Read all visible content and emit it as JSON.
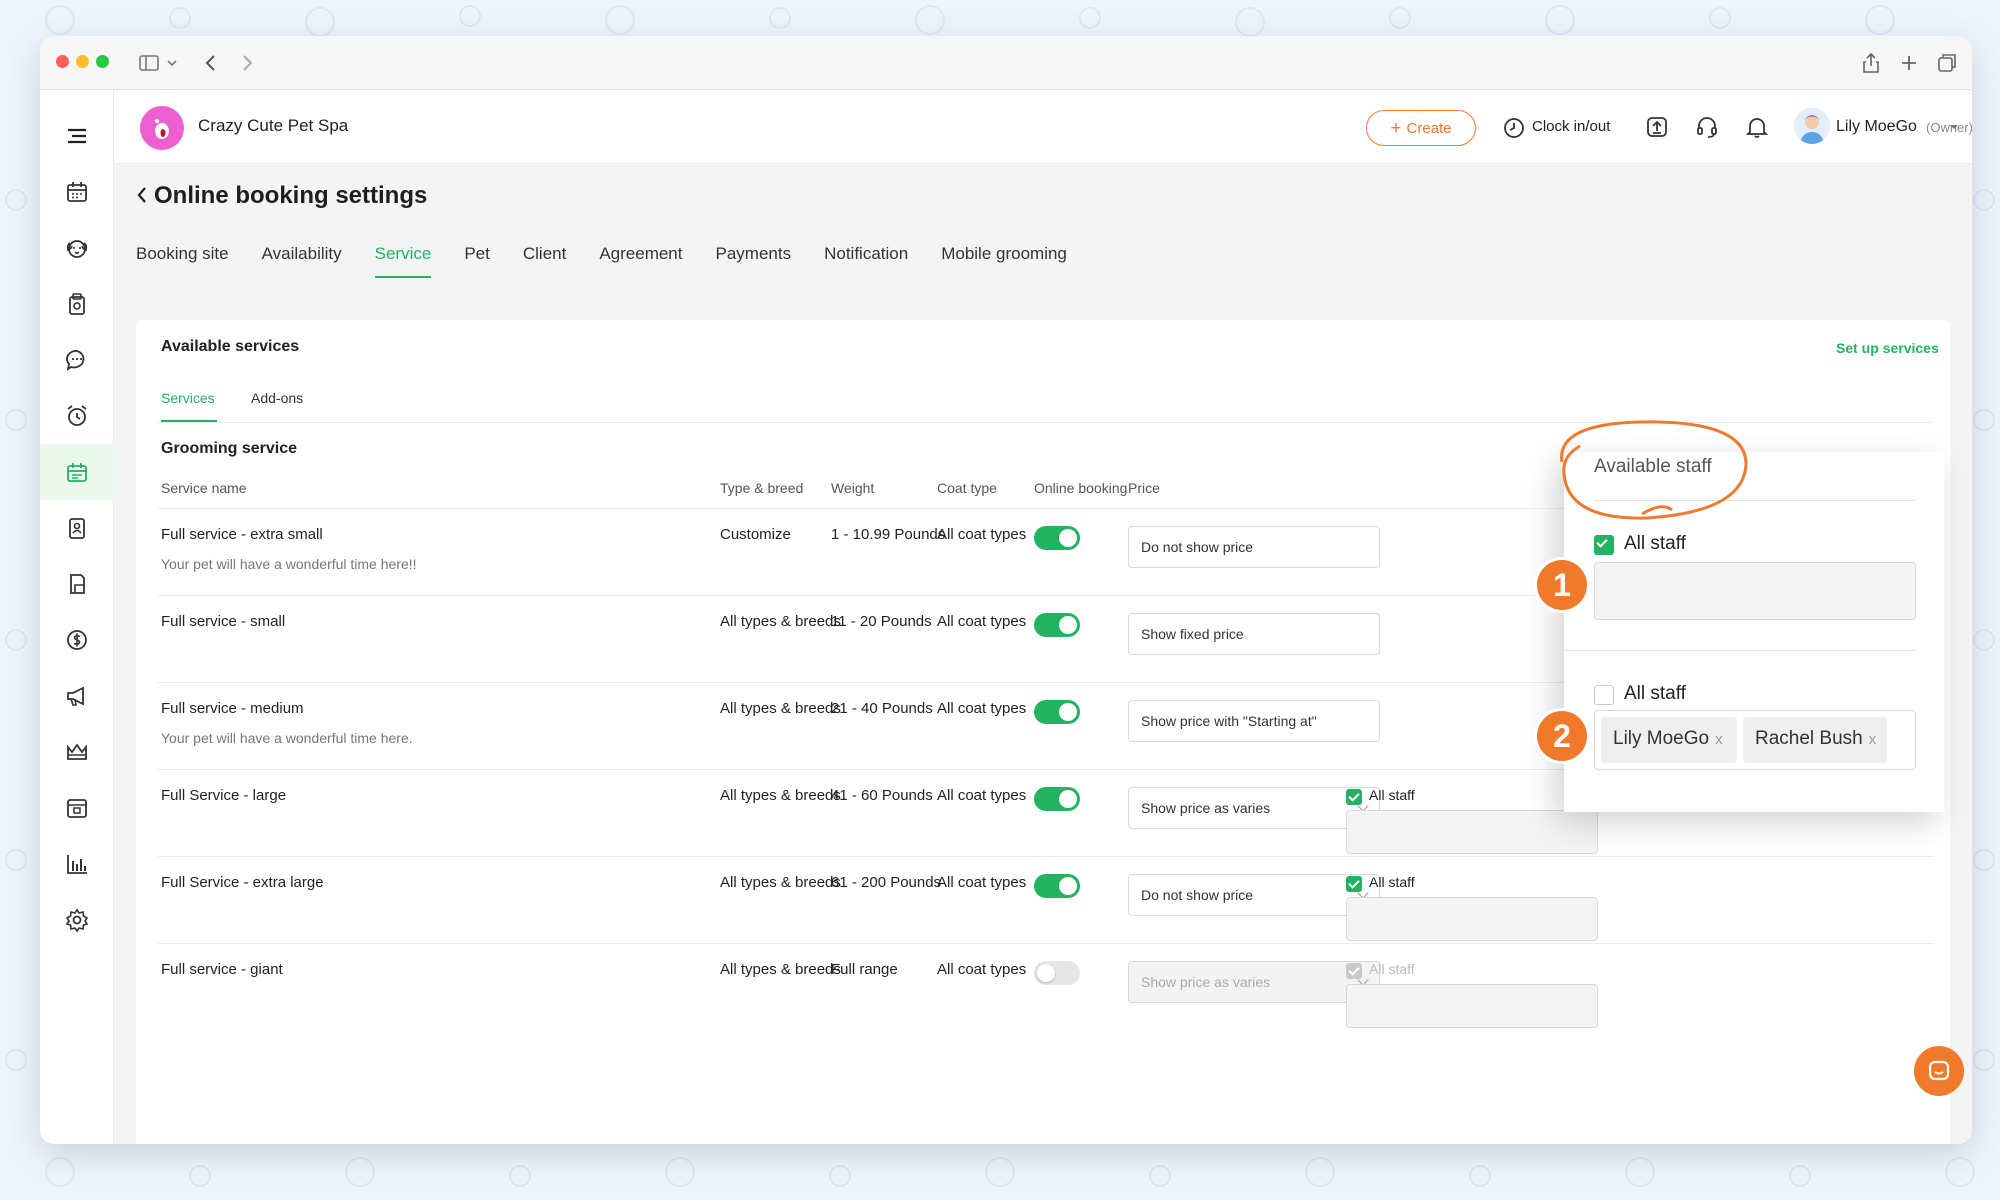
{
  "business": {
    "name": "Crazy Cute Pet Spa"
  },
  "topbar": {
    "create": "Create",
    "clock": "Clock in/out",
    "user_name": "Lily MoeGo",
    "user_role": "(Owner)"
  },
  "page": {
    "title": "Online booking settings"
  },
  "tabs": [
    "Booking site",
    "Availability",
    "Service",
    "Pet",
    "Client",
    "Agreement",
    "Payments",
    "Notification",
    "Mobile grooming"
  ],
  "active_tab": "Service",
  "card": {
    "title": "Available services",
    "setup_link": "Set up services",
    "subtabs": [
      "Services",
      "Add-ons"
    ],
    "section": "Grooming service",
    "headers": {
      "name": "Service name",
      "type": "Type & breed",
      "weight": "Weight",
      "coat": "Coat type",
      "online": "Online booking",
      "price": "Price"
    }
  },
  "rows": [
    {
      "name": "Full service - extra small",
      "desc": "Your pet will have a wonderful time here!!",
      "type": "Customize",
      "weight": "1 - 10.99 Pounds",
      "coat": "All coat types",
      "online": true,
      "price": "Do not show price"
    },
    {
      "name": "Full service - small",
      "desc": "",
      "type": "All types & breeds",
      "weight": "11 - 20 Pounds",
      "coat": "All coat types",
      "online": true,
      "price": "Show fixed price"
    },
    {
      "name": "Full service - medium",
      "desc": "Your pet will have a wonderful time here.",
      "type": "All types & breeds",
      "weight": "21 - 40 Pounds",
      "coat": "All coat types",
      "online": true,
      "price": "Show price with \"Starting at\""
    },
    {
      "name": "Full Service - large",
      "desc": "",
      "type": "All types & breeds",
      "weight": "41 - 60 Pounds",
      "coat": "All coat types",
      "online": true,
      "price": "Show price as varies",
      "staff": "All staff"
    },
    {
      "name": "Full Service - extra large",
      "desc": "",
      "type": "All types & breeds",
      "weight": "61 - 200 Pounds",
      "coat": "All coat types",
      "online": true,
      "price": "Do not show price",
      "staff": "All staff"
    },
    {
      "name": "Full service - giant",
      "desc": "",
      "type": "All types & breeds",
      "weight": "Full range",
      "coat": "All coat types",
      "online": false,
      "price": "Show price as varies",
      "staff": "All staff"
    }
  ],
  "popup": {
    "title": "Available staff",
    "option1": "All staff",
    "option2": "All staff",
    "chips": [
      "Lily MoeGo",
      "Rachel Bush"
    ],
    "chip_close": "x",
    "badge1": "1",
    "badge2": "2"
  },
  "colors": {
    "brand_green": "#21b35f",
    "accent_orange": "#f0792c",
    "page_bg": "#f4f4f4"
  },
  "icons": {
    "sidebar": [
      "calendar-icon",
      "pet-face-icon",
      "clipboard-icon",
      "chat-icon",
      "alarm-icon",
      "booking-calendar-icon",
      "report-card-icon",
      "document-icon",
      "dollar-icon",
      "megaphone-icon",
      "crown-icon",
      "browser-icon",
      "bar-chart-icon",
      "gear-icon"
    ]
  }
}
